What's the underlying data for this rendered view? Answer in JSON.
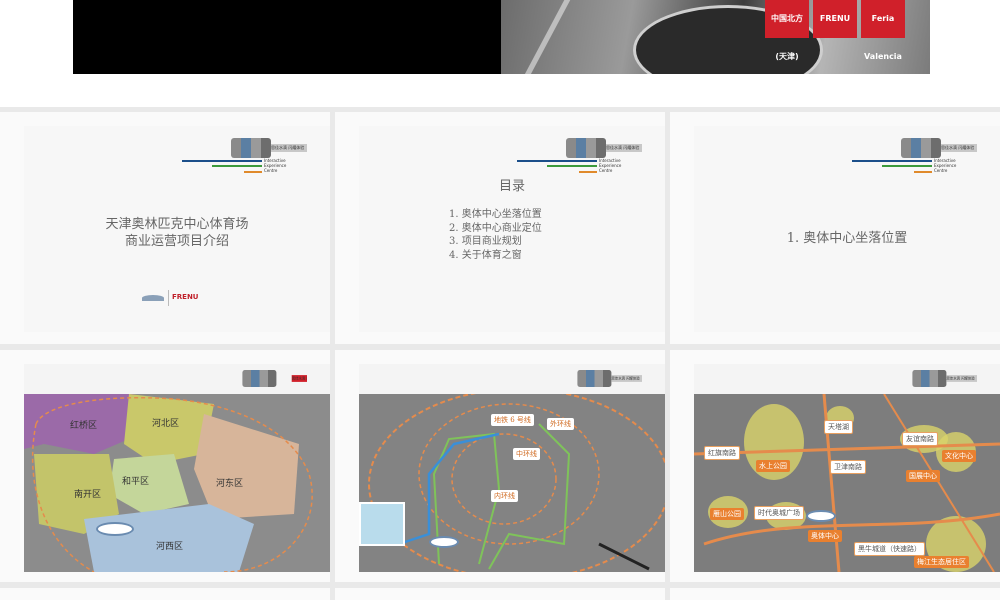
{
  "banner": {
    "logos": [
      "中国北方 (天津)",
      "FRENU",
      "Feria Valencia"
    ]
  },
  "iec_logo": {
    "cn_name": "思佳水滴 闪耀体验",
    "lines": [
      "Interactive",
      "Experience",
      "Centre"
    ]
  },
  "slide1": {
    "title_line1": "天津奥林匹克中心体育场",
    "title_line2": "商业运营项目介绍",
    "bottom_logo": "FRENU"
  },
  "slide2": {
    "heading": "目录",
    "items": [
      "1. 奥体中心坐落位置",
      "2. 奥体中心商业定位",
      "3. 项目商业规划",
      "4. 关于体育之窗"
    ]
  },
  "slide3": {
    "title": "1. 奥体中心坐落位置"
  },
  "slide4": {
    "districts": [
      "红桥区",
      "河北区",
      "和平区",
      "河东区",
      "南开区",
      "河西区"
    ]
  },
  "slide5": {
    "tags": [
      "地铁 6 号线",
      "外环线",
      "中环线",
      "内环线"
    ]
  },
  "slide6": {
    "tags": [
      "天塔湖",
      "友谊南路",
      "红旗南路",
      "水上公园",
      "卫津南路",
      "文化中心",
      "国展中心",
      "雁山公园",
      "时代奥城广场",
      "奥体中心",
      "梅江生态居住区",
      "黑牛城道（快速路）"
    ]
  },
  "colors": {
    "district_red": "#d0202a",
    "orange": "#e9802f",
    "iec_blue": "#1b4f8a",
    "iec_green": "#3c9a3c"
  }
}
